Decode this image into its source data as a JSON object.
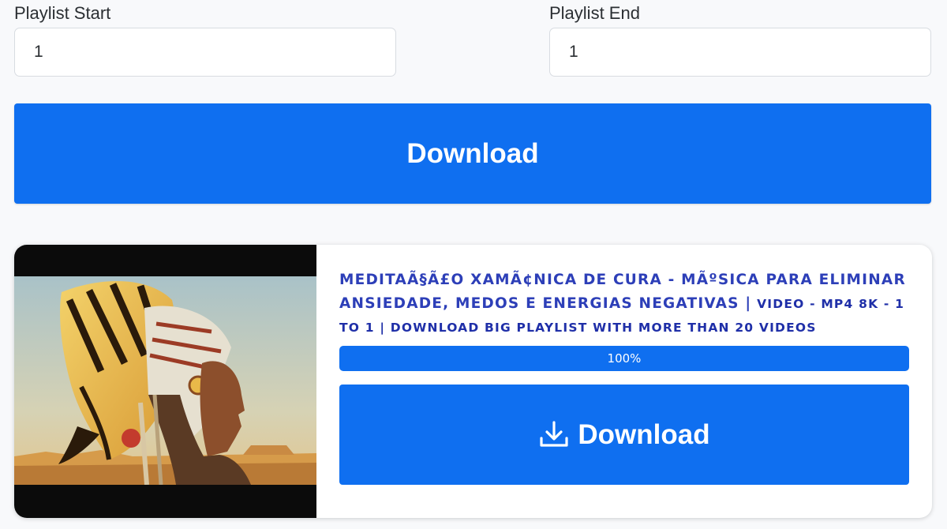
{
  "form": {
    "playlist_start": {
      "label": "Playlist Start",
      "value": "1"
    },
    "playlist_end": {
      "label": "Playlist End",
      "value": "1"
    },
    "download_label": "Download"
  },
  "result": {
    "title_main": "MEDITAÃ§Ã£O XAMÃ¢NICA DE CURA - MÃºSICA PARA ELIMINAR ANSIEDADE, MEDOS E ENERGIAS NEGATIVAS |",
    "title_sub": "VIDEO - MP4 8K - 1 TO 1 | DOWNLOAD BIG PLAYLIST WITH MORE THAN 20 VIDEOS",
    "progress_percent": 100,
    "progress_label": "100%",
    "download_label": "Download",
    "download_icon": "download-tray-icon",
    "thumbnail": "native-chief-butterfly-headdress-painting"
  },
  "colors": {
    "accent": "#0f6ff0",
    "title": "#2d3fb8"
  }
}
